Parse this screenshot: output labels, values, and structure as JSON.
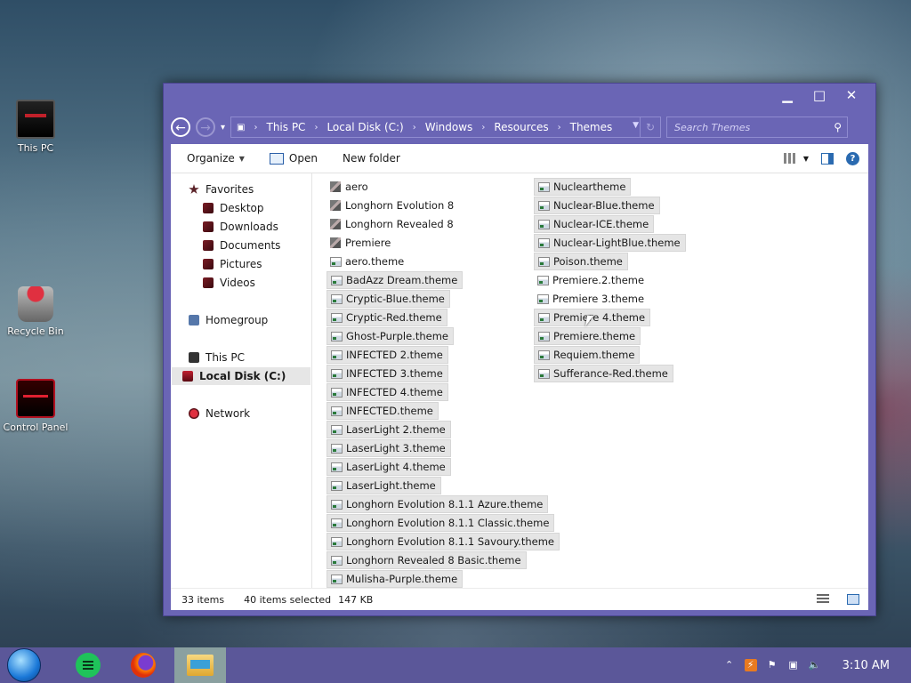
{
  "desktop": {
    "icons": [
      {
        "label": "This PC"
      },
      {
        "label": "Recycle Bin"
      },
      {
        "label": "Control Panel"
      }
    ]
  },
  "window": {
    "controls": {
      "minimize": "▁",
      "maximize": "□",
      "close": "✕"
    },
    "nav": {
      "back": "←",
      "forward": "→",
      "recent": "▾"
    },
    "breadcrumbs": [
      "This PC",
      "Local Disk (C:)",
      "Windows",
      "Resources",
      "Themes"
    ],
    "search": {
      "placeholder": "Search Themes"
    },
    "toolbar": {
      "organize": "Organize",
      "open": "Open",
      "new_folder": "New folder",
      "help": "?"
    },
    "nav_pane": {
      "favorites": "Favorites",
      "desktop": "Desktop",
      "downloads": "Downloads",
      "documents": "Documents",
      "pictures": "Pictures",
      "videos": "Videos",
      "homegroup": "Homegroup",
      "this_pc": "This PC",
      "local_disk": "Local Disk (C:)",
      "network": "Network"
    },
    "files_col1": [
      {
        "name": "aero",
        "type": "folder",
        "selected": false
      },
      {
        "name": "Longhorn Evolution 8",
        "type": "folder",
        "selected": false
      },
      {
        "name": "Longhorn Revealed 8",
        "type": "folder",
        "selected": false
      },
      {
        "name": "Premiere",
        "type": "folder",
        "selected": false
      },
      {
        "name": "aero.theme",
        "type": "theme",
        "selected": false
      },
      {
        "name": "BadAzz Dream.theme",
        "type": "theme",
        "selected": true
      },
      {
        "name": "Cryptic-Blue.theme",
        "type": "theme",
        "selected": true
      },
      {
        "name": "Cryptic-Red.theme",
        "type": "theme",
        "selected": true
      },
      {
        "name": "Ghost-Purple.theme",
        "type": "theme",
        "selected": true
      },
      {
        "name": "INFECTED 2.theme",
        "type": "theme",
        "selected": true
      },
      {
        "name": "INFECTED 3.theme",
        "type": "theme",
        "selected": true
      },
      {
        "name": "INFECTED 4.theme",
        "type": "theme",
        "selected": true
      },
      {
        "name": "INFECTED.theme",
        "type": "theme",
        "selected": true
      },
      {
        "name": "LaserLight 2.theme",
        "type": "theme",
        "selected": true
      },
      {
        "name": "LaserLight 3.theme",
        "type": "theme",
        "selected": true
      },
      {
        "name": "LaserLight 4.theme",
        "type": "theme",
        "selected": true
      },
      {
        "name": "LaserLight.theme",
        "type": "theme",
        "selected": true
      },
      {
        "name": "Longhorn Evolution 8.1.1 Azure.theme",
        "type": "theme",
        "selected": true
      },
      {
        "name": "Longhorn Evolution 8.1.1 Classic.theme",
        "type": "theme",
        "selected": true
      },
      {
        "name": "Longhorn Evolution 8.1.1 Savoury.theme",
        "type": "theme",
        "selected": true
      },
      {
        "name": "Longhorn Revealed 8 Basic.theme",
        "type": "theme",
        "selected": true
      },
      {
        "name": "Mulisha-Purple.theme",
        "type": "theme",
        "selected": true
      }
    ],
    "files_col2": [
      {
        "name": "Nucleartheme",
        "type": "theme",
        "selected": true
      },
      {
        "name": "Nuclear-Blue.theme",
        "type": "theme",
        "selected": true
      },
      {
        "name": "Nuclear-ICE.theme",
        "type": "theme",
        "selected": true
      },
      {
        "name": "Nuclear-LightBlue.theme",
        "type": "theme",
        "selected": true
      },
      {
        "name": "Poison.theme",
        "type": "theme",
        "selected": true
      },
      {
        "name": "Premiere.2.theme",
        "type": "theme",
        "selected": false
      },
      {
        "name": "Premiere 3.theme",
        "type": "theme",
        "selected": false
      },
      {
        "name": "Premiere 4.theme",
        "type": "theme",
        "selected": true
      },
      {
        "name": "Premiere.theme",
        "type": "theme",
        "selected": true
      },
      {
        "name": "Requiem.theme",
        "type": "theme",
        "selected": true
      },
      {
        "name": "Sufferance-Red.theme",
        "type": "theme",
        "selected": true
      }
    ],
    "status": {
      "item_count": "33 items",
      "selected": "40 items selected",
      "size": "147 KB"
    }
  },
  "taskbar": {
    "clock": "3:10 AM"
  },
  "colors": {
    "window_chrome": "#6a65b5",
    "taskbar": "#5b5799",
    "selection": "#e5e5e5"
  }
}
